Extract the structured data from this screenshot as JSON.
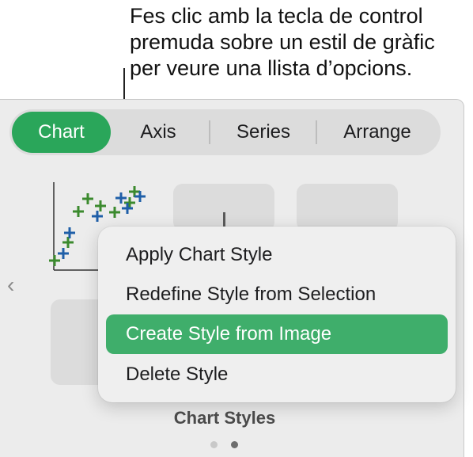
{
  "callout": {
    "lines": [
      "Fes clic amb la tecla de control",
      "premuda sobre un estil de gràfic",
      "per veure una llista d’opcions."
    ]
  },
  "tabs": {
    "chart": "Chart",
    "axis": "Axis",
    "series": "Series",
    "arrange": "Arrange"
  },
  "context_menu": {
    "items": [
      "Apply Chart Style",
      "Redefine Style from Selection",
      "Create Style from Image",
      "Delete Style"
    ],
    "highlighted_index": 2
  },
  "styles_section": {
    "caption": "Chart Styles",
    "page_indicator": {
      "pages": 2,
      "current": 2
    },
    "nav_left_glyph": "‹"
  },
  "colors": {
    "accent_green": "#2aa65a",
    "menu_highlight": "#3fae6b",
    "series_blue": "#1f5fa8",
    "series_green": "#3b8a2e"
  }
}
